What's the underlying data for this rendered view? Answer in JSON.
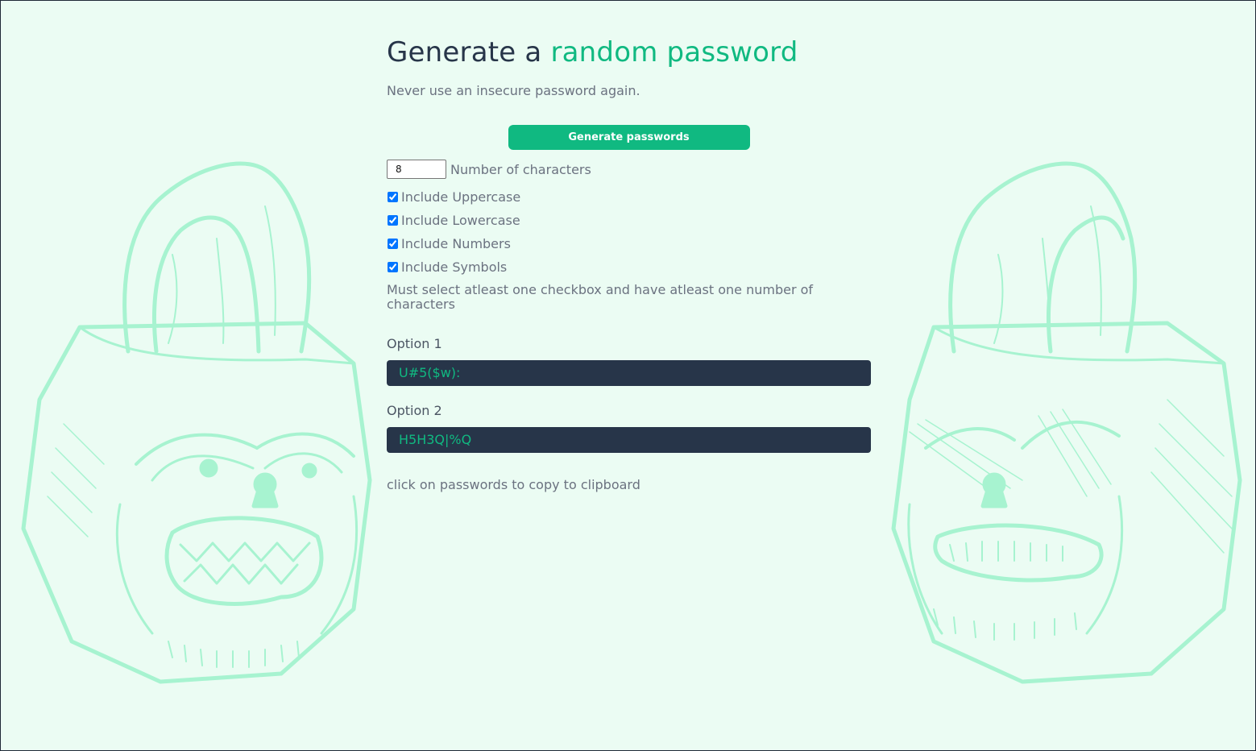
{
  "header": {
    "title_prefix": "Generate a",
    "title_accent": "random password",
    "subtitle": "Never use an insecure password again."
  },
  "generate_button": {
    "label": "Generate passwords"
  },
  "length": {
    "value": "8",
    "label": "Number of characters"
  },
  "checkboxes": [
    {
      "label": "Include Uppercase",
      "checked": true
    },
    {
      "label": "Include Lowercase",
      "checked": true
    },
    {
      "label": "Include Numbers",
      "checked": true
    },
    {
      "label": "Include Symbols",
      "checked": true
    }
  ],
  "warning": "Must select atleast one checkbox and have atleast one number of characters",
  "options": [
    {
      "label": "Option 1",
      "password": "U#5($w):"
    },
    {
      "label": "Option 2",
      "password": "H5H3Q|%Q"
    }
  ],
  "hint": "click on passwords to copy to clipboard",
  "colors": {
    "background": "#ebfcf3",
    "accent": "#10b981",
    "dark": "#273549",
    "illustration": "#a7f3d0"
  },
  "decorations": {
    "left": "angry-padlock-illustration",
    "right": "angry-padlock-illustration"
  }
}
